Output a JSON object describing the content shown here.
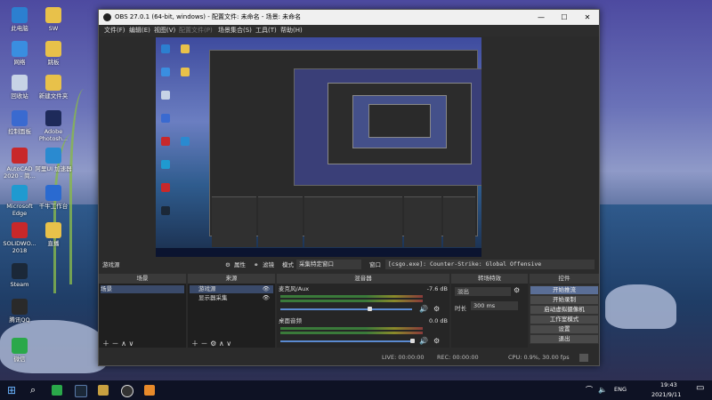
{
  "desktop": {
    "icons": [
      {
        "label": "此电脑",
        "color": "#2c7fd0"
      },
      {
        "label": "SW",
        "color": "#e8c14a"
      },
      {
        "label": "网络",
        "color": "#3a8ee0"
      },
      {
        "label": "跳板",
        "color": "#e8c14a"
      },
      {
        "label": "回收站",
        "color": "#c7d3e6"
      },
      {
        "label": "新建文件夹",
        "color": "#e8c14a"
      },
      {
        "label": "控制面板",
        "color": "#3a6ad0"
      },
      {
        "label": "Adobe Photosh...",
        "color": "#1e2a5a"
      },
      {
        "label": "AutoCAD 2020 - 简...",
        "color": "#c8282a"
      },
      {
        "label": "阿里UI 加速器",
        "color": "#2a8ad0"
      },
      {
        "label": "Microsoft Edge",
        "color": "#1f9ad0"
      },
      {
        "label": "千牛工作台",
        "color": "#2a6ad0"
      },
      {
        "label": "SOLIDWO... 2018",
        "color": "#c8282a"
      },
      {
        "label": "直播",
        "color": "#e8c14a"
      },
      {
        "label": "Steam",
        "color": "#1b2838"
      },
      {
        "label": "腾讯QQ",
        "color": "#2a2a2a"
      },
      {
        "label": "微信",
        "color": "#2aa84a"
      }
    ]
  },
  "obs": {
    "title": "OBS 27.0.1 (64-bit, windows) - 配置文件: 未命名 - 场景: 未命名",
    "window_buttons": {
      "minimize": "—",
      "maximize": "☐",
      "close": "✕"
    },
    "menu": [
      "文件(F)",
      "编辑(E)",
      "视图(V)",
      "配置文件(P)",
      "场景集合(S)",
      "工具(T)",
      "帮助(H)"
    ],
    "source_bar": {
      "no_source": "游戏源",
      "properties": "属性",
      "filters": "滤镜",
      "mode_label": "模式",
      "mode_value": "采集特定窗口",
      "window_label": "窗口",
      "window_value": "[csgo.exe]: Counter-Strike: Global Offensive"
    },
    "scenes": {
      "header": "场景",
      "items": [
        "场景"
      ]
    },
    "sources": {
      "header": "来源",
      "items": [
        "游戏源",
        "显示器采集"
      ]
    },
    "mixer": {
      "header": "混音器",
      "tracks": [
        {
          "name": "麦克风/Aux",
          "db": "-7.6 dB"
        },
        {
          "name": "桌面音频",
          "db": "0.0 dB"
        }
      ]
    },
    "transitions": {
      "header": "转场特效",
      "type": "淡出",
      "duration_label": "时长",
      "duration_value": "300 ms"
    },
    "controls": {
      "header": "控件",
      "buttons": [
        "开始推流",
        "开始录制",
        "启动虚拟摄像机",
        "工作室模式",
        "设置",
        "退出"
      ]
    },
    "status": {
      "live": "LIVE: 00:00:00",
      "rec": "REC: 00:00:00",
      "cpu": "CPU: 0.9%, 30.00 fps"
    }
  },
  "taskbar": {
    "time": "19:43",
    "date": "2021/9/11",
    "lang": "ENG"
  }
}
